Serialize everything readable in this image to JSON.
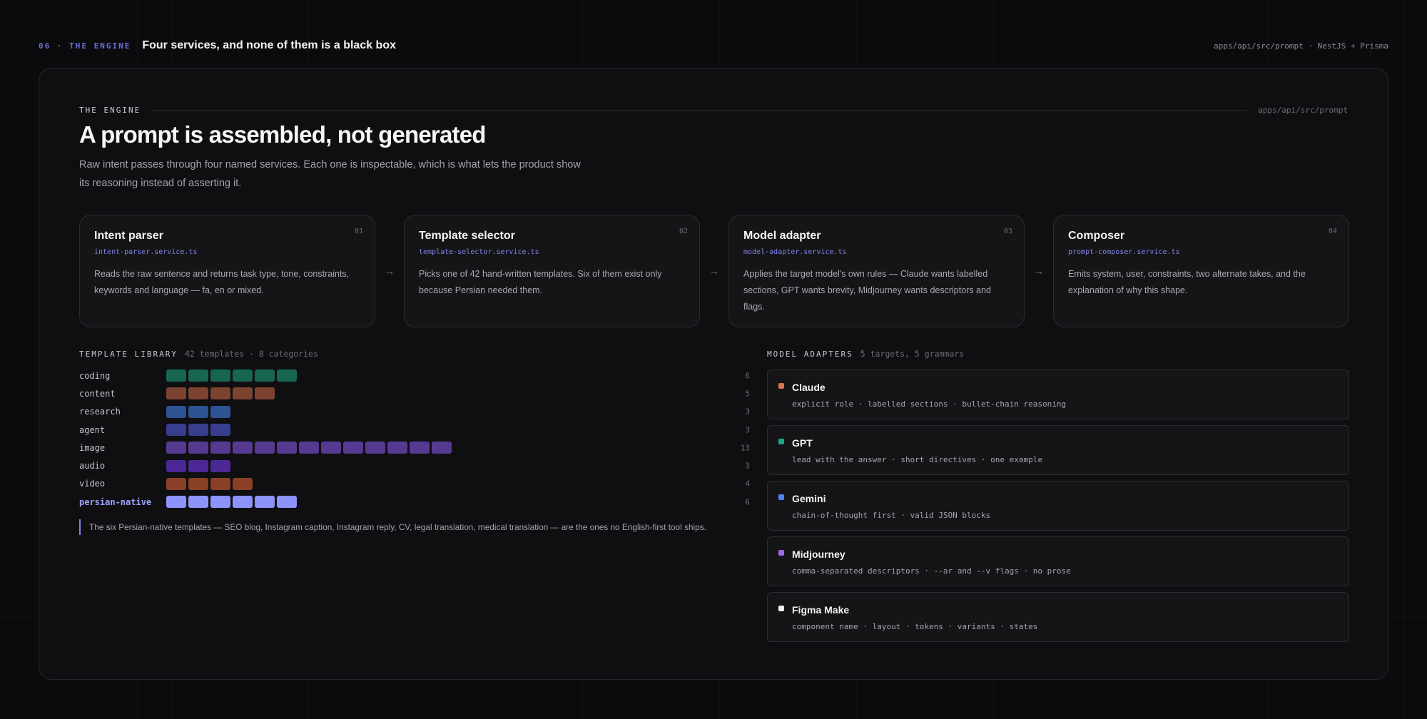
{
  "topbar": {
    "eyebrow": "06 · THE ENGINE",
    "title": "Four services, and none of them is a black box",
    "path": "apps/api/src/prompt · NestJS + Prisma"
  },
  "section": {
    "label": "THE ENGINE",
    "path": "apps/api/src/prompt",
    "headline": "A prompt is assembled, not generated",
    "lede": "Raw intent passes through four named services. Each one is inspectable, which is what lets the product show its reasoning instead of asserting it."
  },
  "services": [
    {
      "num": "01",
      "name": "Intent parser",
      "file": "intent-parser.service.ts",
      "desc": "Reads the raw sentence and returns task type, tone, constraints, keywords and language — fa, en or mixed."
    },
    {
      "num": "02",
      "name": "Template selector",
      "file": "template-selector.service.ts",
      "desc": "Picks one of 42 hand-written templates. Six of them exist only because Persian needed them."
    },
    {
      "num": "03",
      "name": "Model adapter",
      "file": "model-adapter.service.ts",
      "desc": "Applies the target model's own rules — Claude wants labelled sections, GPT wants brevity, Midjourney wants descriptors and flags."
    },
    {
      "num": "04",
      "name": "Composer",
      "file": "prompt-composer.service.ts",
      "desc": "Emits system, user, constraints, two alternate takes, and the explanation of why this shape."
    }
  ],
  "arrow_icon": "arrow-right-icon",
  "library": {
    "label": "TEMPLATE LIBRARY",
    "sub": "42 templates · 8 categories",
    "rows": [
      {
        "name": "coding",
        "count": "6",
        "n": 6,
        "color": "#17664f",
        "highlight": false
      },
      {
        "name": "content",
        "count": "5",
        "n": 5,
        "color": "#7c4330",
        "highlight": false
      },
      {
        "name": "research",
        "count": "3",
        "n": 3,
        "color": "#2d5393",
        "highlight": false
      },
      {
        "name": "agent",
        "count": "3",
        "n": 3,
        "color": "#393d8e",
        "highlight": false
      },
      {
        "name": "image",
        "count": "13",
        "n": 13,
        "color": "#563a92",
        "highlight": false
      },
      {
        "name": "audio",
        "count": "3",
        "n": 3,
        "color": "#4b2896",
        "highlight": false
      },
      {
        "name": "video",
        "count": "4",
        "n": 4,
        "color": "#8a3f27",
        "highlight": false
      },
      {
        "name": "persian-native",
        "count": "6",
        "n": 6,
        "color": "#8e92fb",
        "highlight": true
      }
    ],
    "note": "The six Persian-native templates — SEO blog, Instagram caption, Instagram reply, CV, legal translation, medical translation — are the ones no English-first tool ships."
  },
  "adapters": {
    "label": "MODEL ADAPTERS",
    "sub": "5 targets, 5 grammars",
    "items": [
      {
        "name": "Claude",
        "desc": "explicit role · labelled sections · bullet-chain reasoning",
        "color": "#d9774f"
      },
      {
        "name": "GPT",
        "desc": "lead with the answer · short directives · one example",
        "color": "#1ea88a"
      },
      {
        "name": "Gemini",
        "desc": "chain-of-thought first · valid JSON blocks",
        "color": "#4d86f0"
      },
      {
        "name": "Midjourney",
        "desc": "comma-separated descriptors · --ar and --v flags · no prose",
        "color": "#9b6af0"
      },
      {
        "name": "Figma Make",
        "desc": "component name · layout · tokens · variants · states",
        "color": "#f2f2f2"
      }
    ]
  }
}
